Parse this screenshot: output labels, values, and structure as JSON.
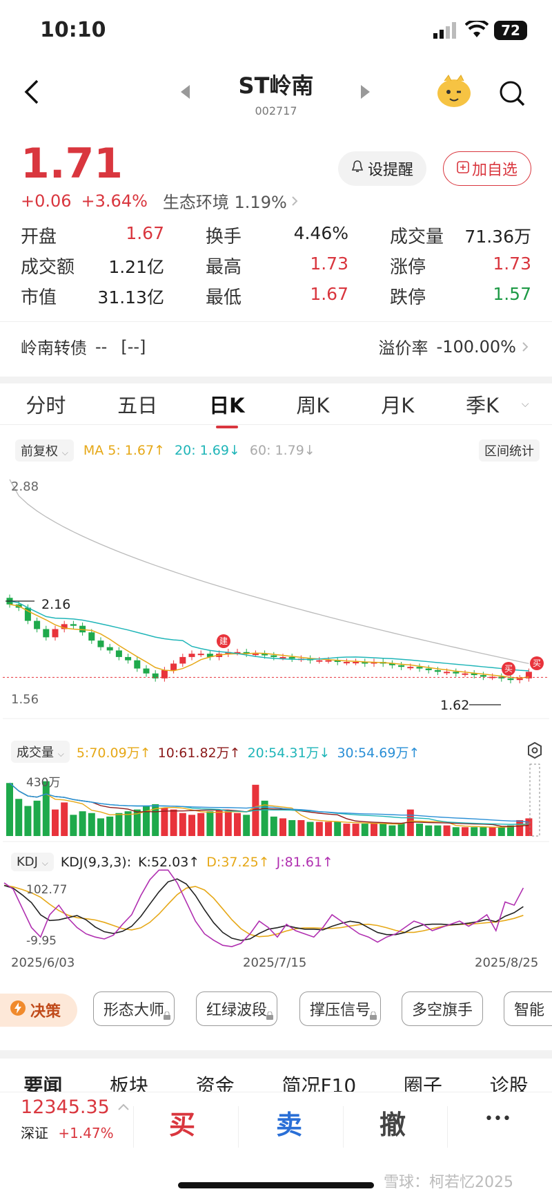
{
  "status": {
    "time": "10:10",
    "battery": "72"
  },
  "header": {
    "title": "ST岭南",
    "code": "002717"
  },
  "quote": {
    "price": "1.71",
    "change": "+0.06",
    "change_pct": "+3.64%",
    "sector": "生态环境 1.19%",
    "alert_btn": "设提醒",
    "watch_btn": "加自选",
    "stats": [
      {
        "label": "开盘",
        "value": "1.67",
        "color": "red"
      },
      {
        "label": "换手",
        "value": "4.46%",
        "color": "black"
      },
      {
        "label": "成交量",
        "value": "71.36万",
        "color": "black"
      },
      {
        "label": "成交额",
        "value": "1.21亿",
        "color": "black"
      },
      {
        "label": "最高",
        "value": "1.73",
        "color": "red"
      },
      {
        "label": "涨停",
        "value": "1.73",
        "color": "red"
      },
      {
        "label": "市值",
        "value": "31.13亿",
        "color": "black"
      },
      {
        "label": "最低",
        "value": "1.67",
        "color": "red"
      },
      {
        "label": "跌停",
        "value": "1.57",
        "color": "green"
      }
    ],
    "bond_label": "岭南转债",
    "bond_value": "--",
    "bond_bracket": "[--]",
    "premium_label": "溢价率",
    "premium_value": "-100.00%"
  },
  "tabs": [
    "分时",
    "五日",
    "日K",
    "周K",
    "月K",
    "季K"
  ],
  "active_tab": "日K",
  "kline": {
    "adjust": "前复权",
    "ma5": "MA 5: 1.67",
    "ma20": "20: 1.69",
    "ma60": "60: 1.79",
    "range_stat": "区间统计",
    "price_high": "2.88",
    "price_low": "1.56",
    "mark_high": "2.16",
    "mark_low": "1.62",
    "badge_build": "建",
    "badge_buy1": "买",
    "badge_buy2": "买",
    "colors": {
      "up": "#e8333b",
      "down": "#1ea94b",
      "ma5": "#e6a817",
      "ma20": "#1fb5b8",
      "ma60": "#bbbbbb"
    }
  },
  "volume": {
    "label": "成交量",
    "v5": "5:70.09万",
    "v10": "10:61.82万",
    "v20": "20:54.31万",
    "v30": "30:54.69万",
    "max": "430万"
  },
  "kdj": {
    "label": "KDJ",
    "params": "KDJ(9,3,3):",
    "k": "K:52.03",
    "d": "D:37.25",
    "j": "J:81.61",
    "top": "102.77",
    "bottom": "-9.95",
    "dates": [
      "2025/6/03",
      "2025/7/15",
      "2025/8/25"
    ]
  },
  "tools": {
    "decision": "决策",
    "items": [
      "形态大师",
      "红绿波段",
      "撑压信号",
      "多空旗手",
      "智能"
    ]
  },
  "news_tabs": [
    "要闻",
    "板块",
    "资金",
    "简况F10",
    "圈子",
    "诊股"
  ],
  "bottom": {
    "index_value": "12345.35",
    "index_name": "深证",
    "index_pct": "+1.47%",
    "buy": "买",
    "sell": "卖",
    "cancel": "撤",
    "more": "•••",
    "watermark": "雪球：柯若忆2025"
  }
}
